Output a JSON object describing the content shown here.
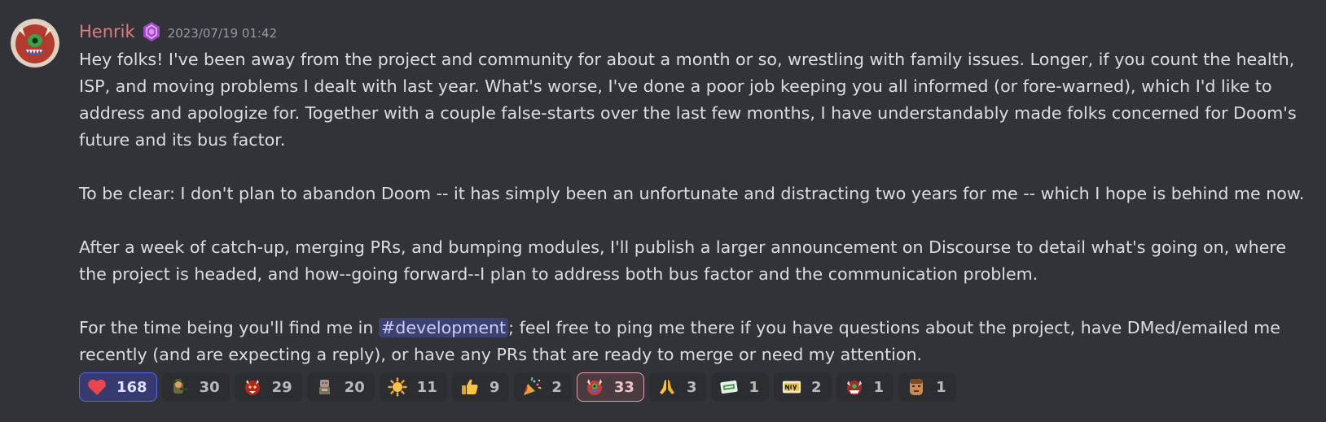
{
  "author": {
    "name": "Henrik",
    "timestamp": "2023/07/19 01:42",
    "role_icon": "hexagon-role-icon",
    "avatar": "red-demon-cacodemon-avatar"
  },
  "message": {
    "paragraphs": [
      "Hey folks! I've been away from the project and community for about a month or so, wrestling with family issues. Longer, if you count the health, ISP, and moving problems I dealt with last year. What's worse, I've done a poor job keeping you all informed (or fore-warned), which I'd like to address and apologize for. Together with a couple false-starts over the last few months, I have understandably made folks concerned for Doom's future and its bus factor.",
      "To be clear: I don't plan to abandon Doom -- it has simply been an unfortunate and distracting two years for me -- which I hope is behind me now.",
      "After a week of catch-up, merging PRs, and bumping modules, I'll publish a larger announcement on Discourse to detail what's going on, where the project is headed, and how--going forward--I plan to address both bus factor and the communication problem."
    ],
    "last_paragraph": {
      "before": "For the time being you'll find me in ",
      "channel": "#development",
      "after": "; feel free to ping me there if you have questions about the project, have DMed/emailed me recently (and are expecting a reply), or have any PRs that are ready to merge or need my attention."
    }
  },
  "reactions": [
    {
      "emoji": "heart-icon",
      "count": "168"
    },
    {
      "emoji": "soldier-emoji-icon",
      "count": "30"
    },
    {
      "emoji": "red-demon-emoji-icon",
      "count": "29"
    },
    {
      "emoji": "robot-emoji-icon",
      "count": "20"
    },
    {
      "emoji": "sun-emoji-icon",
      "count": "11"
    },
    {
      "emoji": "thumbs-up-icon",
      "count": "9"
    },
    {
      "emoji": "party-popper-icon",
      "count": "2"
    },
    {
      "emoji": "doom-clown-emoji-icon",
      "count": "33"
    },
    {
      "emoji": "folded-hands-icon",
      "count": "3"
    },
    {
      "emoji": "goal-sticker-icon",
      "count": "1"
    },
    {
      "emoji": "nice-sticker-icon",
      "count": "2"
    },
    {
      "emoji": "cacodemon-emoji-icon",
      "count": "1"
    },
    {
      "emoji": "doomguy-face-icon",
      "count": "1"
    }
  ],
  "colors": {
    "background": "#313338",
    "username": "#e27a7e",
    "mention_bg": "#3c4270",
    "reaction_me_border": "#5865f2"
  }
}
